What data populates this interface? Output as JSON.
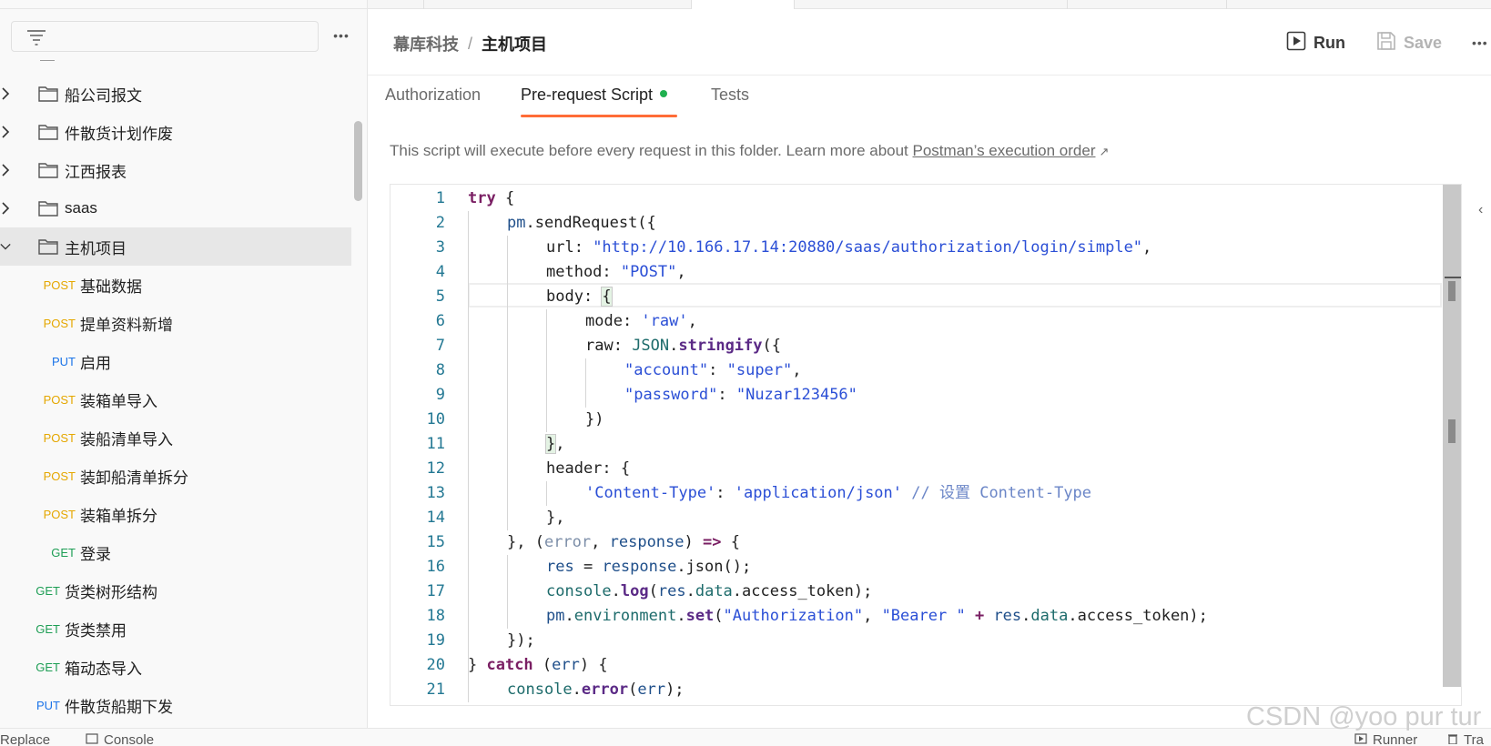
{
  "sidebar": {
    "filter_placeholder": "",
    "more_label": "•••",
    "folders": [
      {
        "label": "船公司报文",
        "expanded": false
      },
      {
        "label": "件散货计划作废",
        "expanded": false
      },
      {
        "label": "江西报表",
        "expanded": false
      },
      {
        "label": "saas",
        "expanded": false
      },
      {
        "label": "主机项目",
        "expanded": true,
        "selected": true
      }
    ],
    "requests": [
      {
        "method": "POST",
        "label": "基础数据"
      },
      {
        "method": "POST",
        "label": "提单资料新增"
      },
      {
        "method": "PUT",
        "label": "启用"
      },
      {
        "method": "POST",
        "label": "装箱单导入"
      },
      {
        "method": "POST",
        "label": "装船清单导入"
      },
      {
        "method": "POST",
        "label": "装卸船清单拆分"
      },
      {
        "method": "POST",
        "label": "装箱单拆分"
      },
      {
        "method": "GET",
        "label": "登录"
      },
      {
        "method": "GET",
        "label": "货类树形结构"
      },
      {
        "method": "GET",
        "label": "货类禁用"
      },
      {
        "method": "GET",
        "label": "箱动态导入"
      },
      {
        "method": "PUT",
        "label": "件散货船期下发"
      }
    ]
  },
  "header": {
    "breadcrumb_parent": "幕库科技",
    "breadcrumb_sep": "/",
    "breadcrumb_current": "主机项目",
    "run_label": "Run",
    "save_label": "Save",
    "more_label": "•••"
  },
  "tabs": {
    "authorization": "Authorization",
    "prerequest": "Pre-request Script",
    "tests": "Tests"
  },
  "info": {
    "text": "This script will execute before every request in this folder. Learn more about ",
    "link": "Postman’s execution order",
    "link_icon": "↗"
  },
  "editor": {
    "line_numbers": [
      "1",
      "2",
      "3",
      "4",
      "5",
      "6",
      "7",
      "8",
      "9",
      "10",
      "11",
      "12",
      "13",
      "14",
      "15",
      "16",
      "17",
      "18",
      "19",
      "20",
      "21"
    ]
  },
  "bottombar": {
    "replace_label": "Replace",
    "console_label": "Console",
    "runner_label": "Runner",
    "trash_label": "Tra"
  },
  "watermark": "CSDN @yoo pur tur",
  "colors": {
    "post": "#e5a700",
    "get": "#1e9e55",
    "put": "#1a73e8",
    "accent": "#ff6c37",
    "dot": "#1fb04f"
  }
}
